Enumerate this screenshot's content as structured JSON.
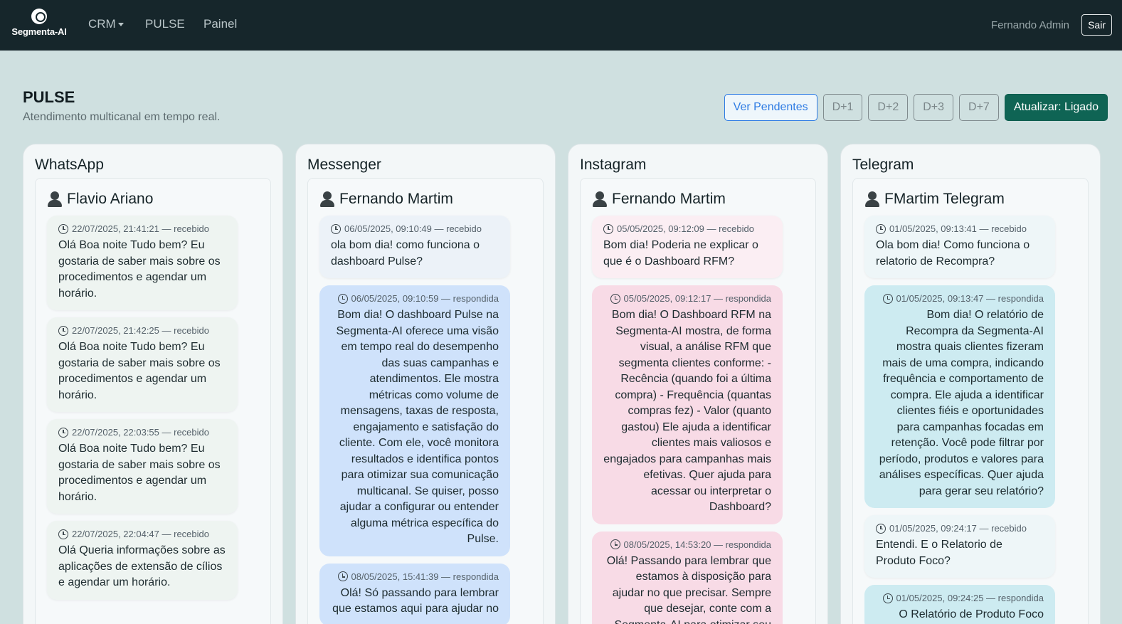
{
  "nav": {
    "logo_text": "Segmenta-AI",
    "links": {
      "crm": "CRM",
      "pulse": "PULSE",
      "painel": "Painel"
    },
    "user": "Fernando Admin",
    "logout": "Sair"
  },
  "page": {
    "title": "PULSE",
    "subtitle": "Atendimento multicanal em tempo real."
  },
  "toolbar": {
    "pending": "Ver Pendentes",
    "d1": "D+1",
    "d2": "D+2",
    "d3": "D+3",
    "d7": "D+7",
    "refresh": "Atualizar: Ligado"
  },
  "colors": {
    "navbar": "#16262b",
    "accent": "#0f6454",
    "primary": "#2d7be3"
  },
  "channels": [
    {
      "name": "WhatsApp",
      "contact": "Flavio Ariano",
      "messages": [
        {
          "meta": "22/07/2025, 21:41:21 — recebido",
          "text": "Olá Boa noite Tudo bem? Eu gostaria de saber mais sobre os procedimentos e agendar um horário."
        },
        {
          "meta": "22/07/2025, 21:42:25 — recebido",
          "text": "Olá Boa noite Tudo bem? Eu gostaria de saber mais sobre os procedimentos e agendar um horário."
        },
        {
          "meta": "22/07/2025, 22:03:55 — recebido",
          "text": "Olá Boa noite Tudo bem? Eu gostaria de saber mais sobre os procedimentos e agendar um horário."
        },
        {
          "meta": "22/07/2025, 22:04:47 — recebido",
          "text": "Olá Queria informações sobre as aplicações de extensão de cílios e agendar um horário."
        }
      ]
    },
    {
      "name": "Messenger",
      "contact": "Fernando Martim",
      "messages": [
        {
          "meta": "06/05/2025, 09:10:49 — recebido",
          "text": "ola bom dia! como funciona o dashboard Pulse?"
        },
        {
          "meta": "06/05/2025, 09:10:59 — respondida",
          "text": "Bom dia! O dashboard Pulse na Segmenta-AI oferece uma visão em tempo real do desempenho das suas campanhas e atendimentos. Ele mostra métricas como volume de mensagens, taxas de resposta, engajamento e satisfação do cliente. Com ele, você monitora resultados e identifica pontos para otimizar sua comunicação multicanal. Se quiser, posso ajudar a configurar ou entender alguma métrica específica do Pulse."
        },
        {
          "meta": "08/05/2025, 15:41:39 — respondida",
          "text": "Olá! Só passando para lembrar que estamos aqui para ajudar no"
        }
      ]
    },
    {
      "name": "Instagram",
      "contact": "Fernando Martim",
      "messages": [
        {
          "meta": "05/05/2025, 09:12:09 — recebido",
          "text": "Bom dia! Poderia ne explicar o que é o Dashboard RFM?"
        },
        {
          "meta": "05/05/2025, 09:12:17 — respondida",
          "text": "Bom dia! O Dashboard RFM na Segmenta-AI mostra, de forma visual, a análise RFM que segmenta clientes conforme: - Recência (quando foi a última compra) - Frequência (quantas compras fez) - Valor (quanto gastou) Ele ajuda a identificar clientes mais valiosos e engajados para campanhas mais efetivas. Quer ajuda para acessar ou interpretar o Dashboard?"
        },
        {
          "meta": "08/05/2025, 14:53:20 — respondida",
          "text": "Olá! Passando para lembrar que estamos à disposição para ajudar no que precisar. Sempre que desejar, conte com a Segmenta-AI para otimizar seu"
        }
      ]
    },
    {
      "name": "Telegram",
      "contact": "FMartim Telegram",
      "messages": [
        {
          "meta": "01/05/2025, 09:13:41 — recebido",
          "text": "Ola bom dia! Como funciona o relatorio de Recompra?"
        },
        {
          "meta": "01/05/2025, 09:13:47 — respondida",
          "text": "Bom dia! O relatório de Recompra da Segmenta-AI mostra quais clientes fizeram mais de uma compra, indicando frequência e comportamento de compra. Ele ajuda a identificar clientes fiéis e oportunidades para campanhas focadas em retenção. Você pode filtrar por período, produtos e valores para análises específicas. Quer ajuda para gerar seu relatório?"
        },
        {
          "meta": "01/05/2025, 09:24:17 — recebido",
          "text": "Entendi. E o Relatorio de Produto Foco?"
        },
        {
          "meta": "01/05/2025, 09:24:25 — respondida",
          "text": "O Relatório de Produto Foco"
        }
      ]
    }
  ]
}
